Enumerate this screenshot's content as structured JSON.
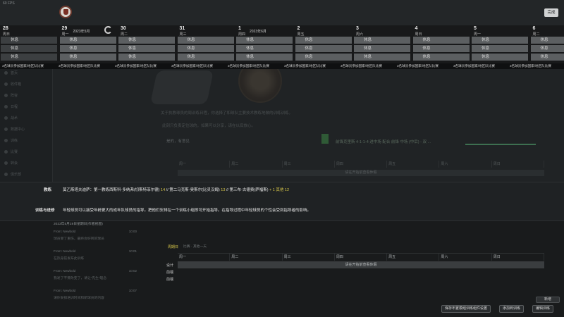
{
  "topbar": {
    "fps": "60 FPS",
    "close_label": "完成"
  },
  "calendar": {
    "days": [
      {
        "date": "28",
        "weekday": "周日",
        "month": "",
        "slots": [
          "休息",
          "休息",
          "休息"
        ],
        "note": "3名球员参加国家/地区队比赛"
      },
      {
        "date": "29",
        "weekday": "周一",
        "month": "2023年5月",
        "slots": [
          "休息",
          "休息",
          "休息"
        ],
        "note": "3名球员参加国家/地区队比赛"
      },
      {
        "date": "30",
        "weekday": "周二",
        "month": "",
        "slots": [
          "休息",
          "休息",
          "休息"
        ],
        "note": "3名球员参加国家/地区队比赛"
      },
      {
        "date": "31",
        "weekday": "周三",
        "month": "",
        "slots": [
          "休息",
          "休息",
          "休息"
        ],
        "note": "3名球员参加国家/地区队比赛"
      },
      {
        "date": "1",
        "weekday": "周四",
        "month": "2023年6月",
        "slots": [
          "休息",
          "休息",
          "休息"
        ],
        "note": "3名球员参加国家/地区队比赛"
      },
      {
        "date": "2",
        "weekday": "周五",
        "month": "",
        "slots": [
          "休息",
          "休息",
          "休息"
        ],
        "note": "3名球员参加国家/地区队比赛"
      },
      {
        "date": "3",
        "weekday": "周六",
        "month": "",
        "slots": [
          "休息",
          "休息",
          "休息"
        ],
        "note": "3名球员参加国家/地区队比赛"
      },
      {
        "date": "4",
        "weekday": "周日",
        "month": "",
        "slots": [
          "休息",
          "休息",
          "休息"
        ],
        "note": "3名球员参加国家/地区队比赛"
      },
      {
        "date": "5",
        "weekday": "周一",
        "month": "",
        "slots": [
          "休息",
          "休息",
          "休息"
        ],
        "note": "3名球员参加国家/地区队比赛"
      },
      {
        "date": "6",
        "weekday": "周二",
        "month": "",
        "slots": [
          "休息",
          "休息",
          "休息"
        ],
        "note": "3名球员参加国家/地区队比赛"
      }
    ]
  },
  "background": {
    "sidebar_items": [
      "首页",
      "收件箱",
      "阵容",
      "日程",
      "战术",
      "数据中心",
      "训练",
      "比赛",
      "转会",
      "俱乐部",
      "财政",
      "俱乐部愿景"
    ],
    "line1": "关于执教球员的周训练日程，你选择了和球队主要技术教练地做的训练训练。",
    "line2": "此刻只负责定位球的，如果可以分享，请在以后放心。",
    "line3": "是的，有意见",
    "weekdays": [
      "周一",
      "周二",
      "周三",
      "周四",
      "周五",
      "周六",
      "周日"
    ],
    "bar_text": "请在开始前查看休假",
    "match_tag": "比赛日",
    "match_text": "前锋克里斯 4-1-1-4 进中场 配合 前锋 中场 (中后) - 双 ..."
  },
  "info": {
    "row1_label": "教练",
    "row1_prefix": "莫乙斯塔夫迪萨：第一教练西斯科·多纳弗(切斯特菲尔德) ",
    "row1_val1": "14",
    "row1_mid": " // 第二马克斯·奥斯尔(比灵汉姆) ",
    "row1_val2": "13",
    "row1_mid2": " // 第三布·古德费(萨福斯) ",
    "row1_val3": "+ 1 其他 12",
    "row2_label": "训练与进修",
    "row2_text": "年轻球员可以接受年龄更大的成年队球员的指导。把他们安排在一个训练小组即可开始指导。在指导过程中年轻球员的个性会受到指导者的影响。"
  },
  "feed": {
    "header": "2023年5月28日星期日(作者视图)",
    "entries": [
      {
        "who": "From: Newbold",
        "msg": "球员受了重伤，最终会好转的球员",
        "time": "10:00"
      },
      {
        "who": "From: Newbold",
        "msg": "在热身前发布此训练",
        "time": "10:01"
      },
      {
        "who": "From: Newbold",
        "msg": "我发了不要改变了，请让“先生”理念",
        "time": "10:02"
      },
      {
        "who": "From: Newbold",
        "msg": "请你安排培训时间和新球员的内容",
        "time": "10:07"
      }
    ]
  },
  "schedule": {
    "title": "周期日",
    "selector": "比赛 · 其他一天",
    "weekdays": [
      "周一",
      "周二",
      "周三",
      "周四",
      "周五",
      "周六",
      "周日"
    ],
    "bar_text": "请在开始前查看休假",
    "side_labels": [
      "设计",
      "前端",
      "前端"
    ]
  },
  "footer": {
    "mini_button": "新增",
    "buttons": [
      "保存布置模组训练组件设置",
      "添加到训练",
      "编辑训练"
    ]
  }
}
